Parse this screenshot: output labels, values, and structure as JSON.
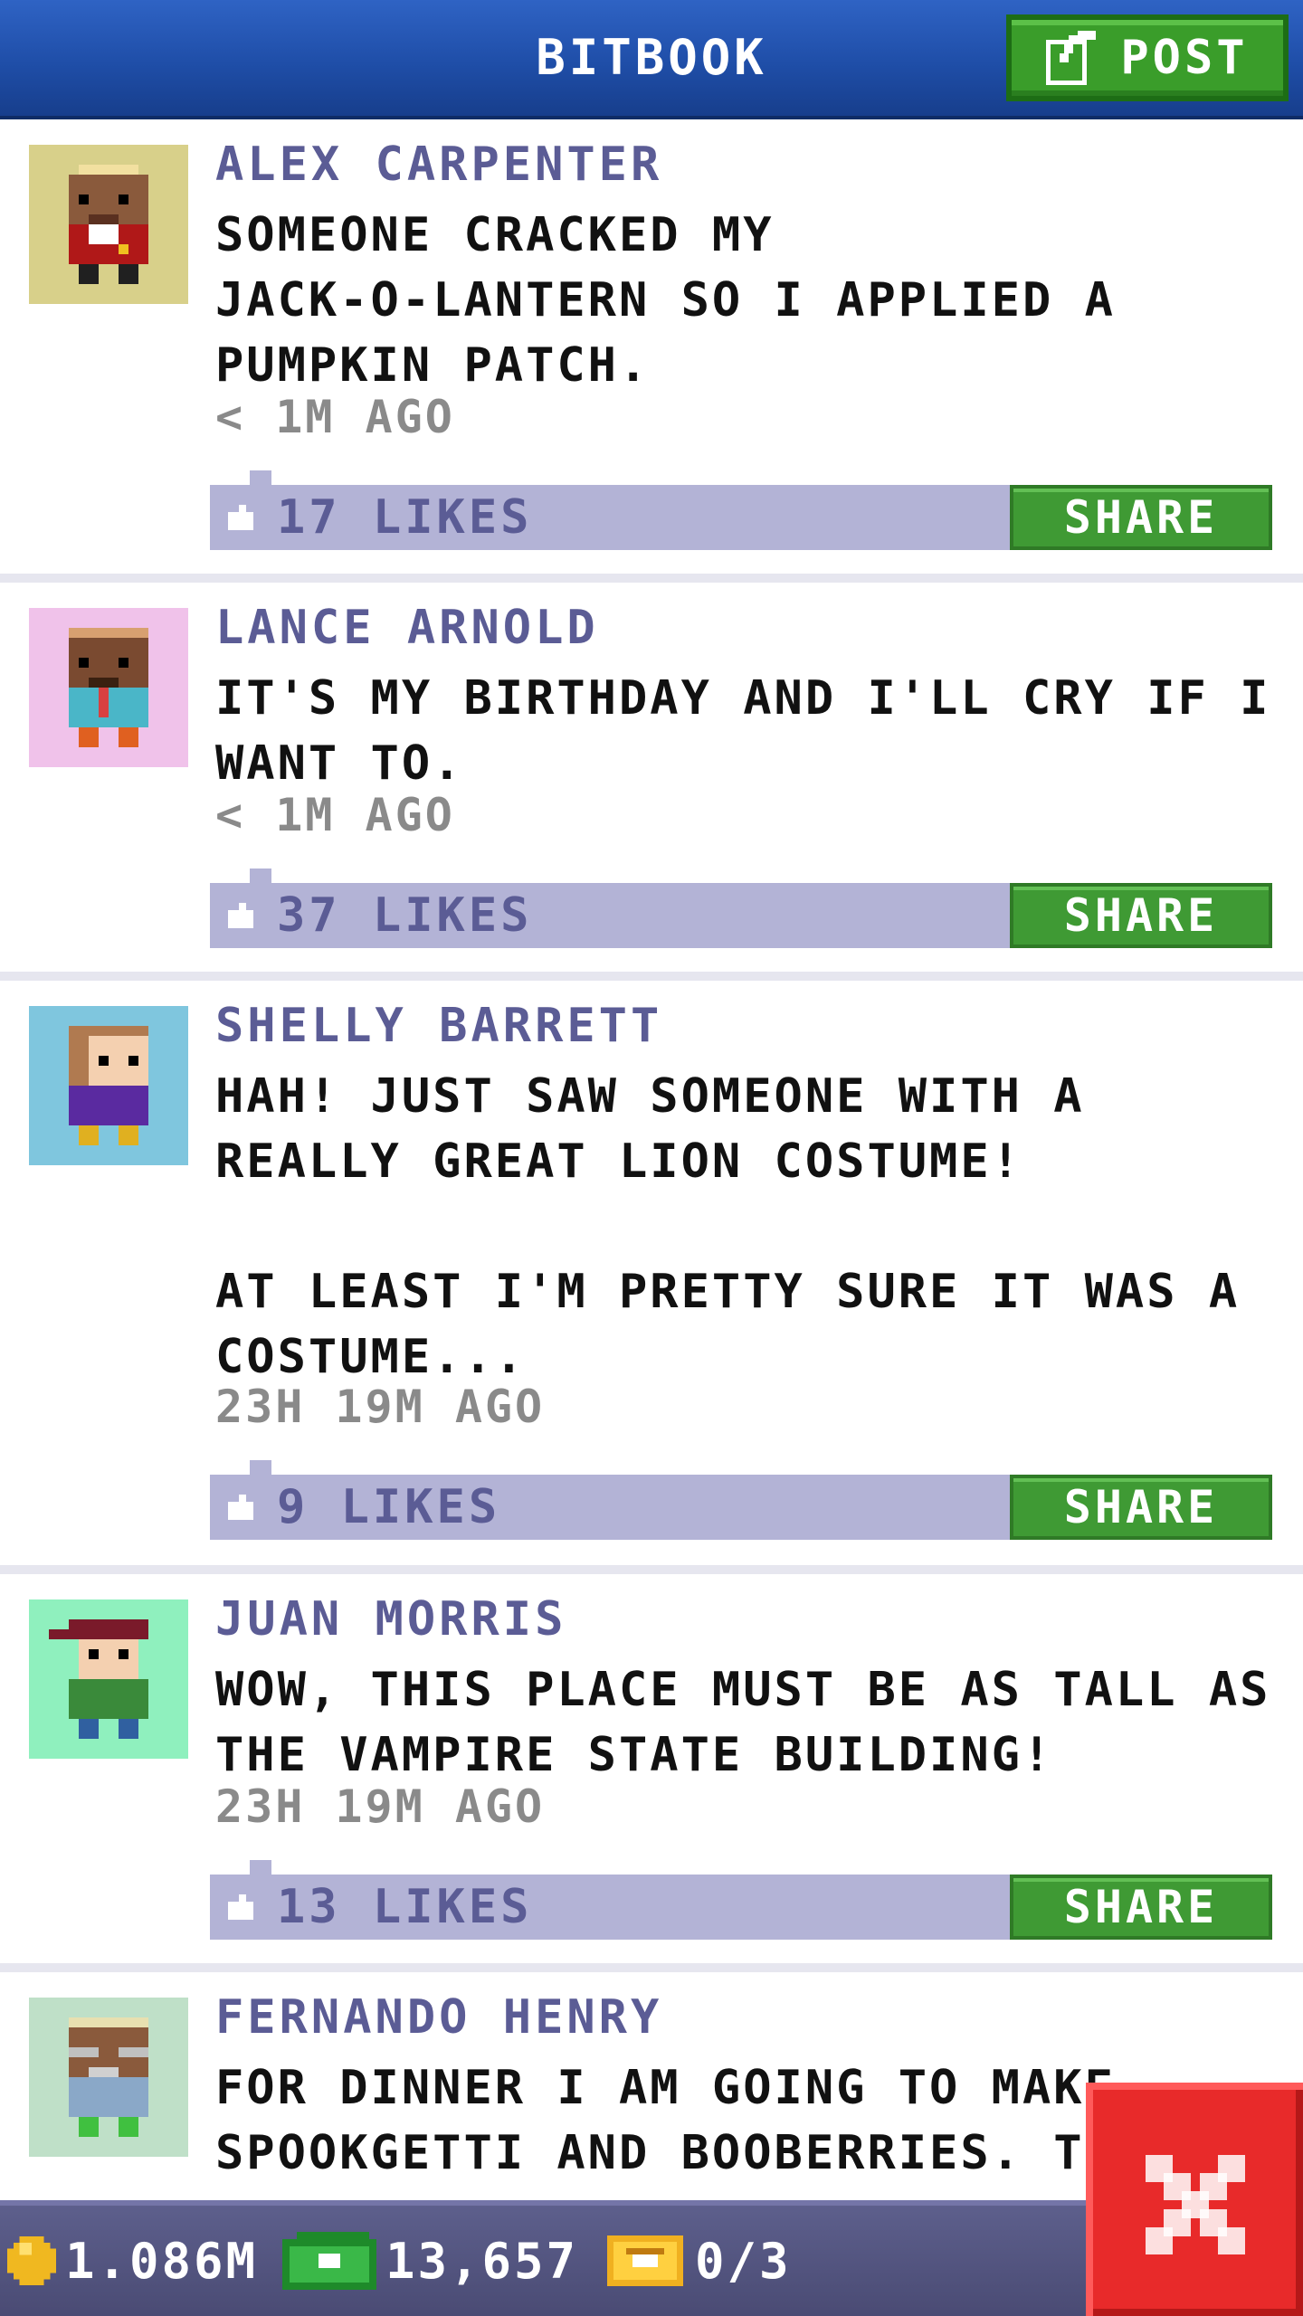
{
  "header": {
    "title": "BITBOOK",
    "post_label": "POST"
  },
  "posts": [
    {
      "author": "ALEX CARPENTER",
      "message": "SOMEONE CRACKED MY\nJACK-O-LANTERN SO I APPLIED A\nPUMPKIN PATCH.",
      "time": "< 1M AGO",
      "likes": "17 LIKES",
      "share_label": "SHARE",
      "avatar_bg": "#d8d08a"
    },
    {
      "author": "LANCE ARNOLD",
      "message": "IT'S MY BIRTHDAY AND I'LL CRY IF I\nWANT TO.",
      "time": "< 1M AGO",
      "likes": "37 LIKES",
      "share_label": "SHARE",
      "avatar_bg": "#f0c2ea"
    },
    {
      "author": "SHELLY BARRETT",
      "message": "HAH! JUST SAW SOMEONE WITH A\nREALLY GREAT LION COSTUME!\n\nAT LEAST I'M PRETTY SURE IT WAS A\nCOSTUME...",
      "time": "23H 19M AGO",
      "likes": "9 LIKES",
      "share_label": "SHARE",
      "avatar_bg": "#7fc6de"
    },
    {
      "author": "JUAN MORRIS",
      "message": "WOW, THIS PLACE MUST BE AS TALL AS\nTHE VAMPIRE STATE BUILDING!",
      "time": "23H 19M AGO",
      "likes": "13 LIKES",
      "share_label": "SHARE",
      "avatar_bg": "#8ff0be"
    },
    {
      "author": "FERNANDO HENRY",
      "message": "FOR DINNER I AM GOING TO MAKE\nSPOOKGETTI AND BOOBERRIES. T",
      "time": "",
      "likes": "",
      "share_label": "",
      "avatar_bg": "#bfe0c8"
    }
  ],
  "bottom_bar": {
    "coins": "1.086M",
    "cash": "13,657",
    "tickets": "0/3"
  },
  "colors": {
    "header_blue": "#1f4ea8",
    "share_green": "#3f9a34",
    "like_bar": "#b3b3d6",
    "author_text": "#5b5c95",
    "close_red": "#e82a2a"
  },
  "icons": [
    "edit-icon",
    "like-icon",
    "coin-icon",
    "cash-icon",
    "ticket-icon",
    "close-icon"
  ]
}
